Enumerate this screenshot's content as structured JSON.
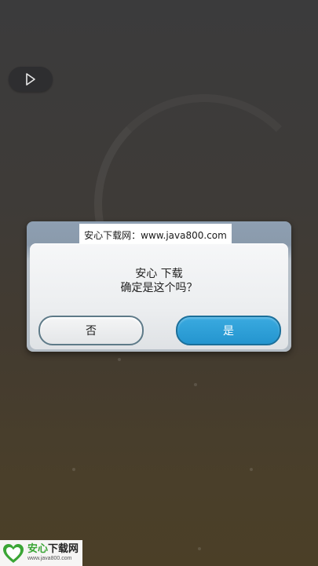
{
  "dialog": {
    "watermark": "安心下载网：www.java800.com",
    "line1": "安心 下载",
    "line2": "确定是这个吗？",
    "no_label": "否",
    "yes_label": "是"
  },
  "play_button": {
    "icon": "play-icon"
  },
  "logo": {
    "title_green": "安心",
    "title_dark": "下载网",
    "url": "www.java800.com"
  },
  "colors": {
    "yes_button": "#2495cf",
    "no_button_border": "#5e7a88",
    "logo_green": "#3aa535"
  }
}
